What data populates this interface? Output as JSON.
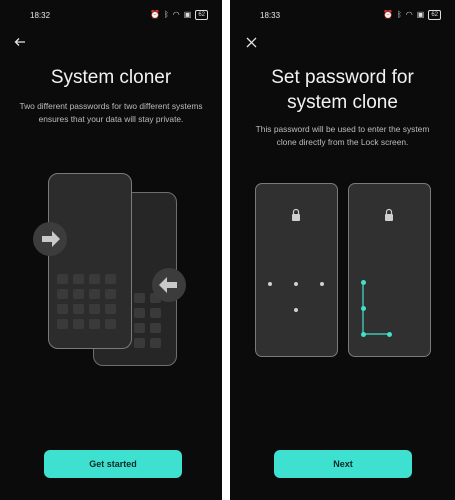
{
  "left": {
    "time": "18:32",
    "battery": "62",
    "title": "System cloner",
    "description": "Two different passwords for two different systems ensures that your data will stay private.",
    "primary_button": "Get started",
    "nav_icon": "back-arrow-icon"
  },
  "right": {
    "time": "18:33",
    "battery": "62",
    "title_line1": "Set password for",
    "title_line2": "system clone",
    "description": "This password will be used to enter the system clone directly from the Lock screen.",
    "primary_button": "Next",
    "nav_icon": "close-icon"
  },
  "colors": {
    "accent": "#3ee0cf",
    "background": "#0b0b0b",
    "pattern": "#41e0cc"
  }
}
